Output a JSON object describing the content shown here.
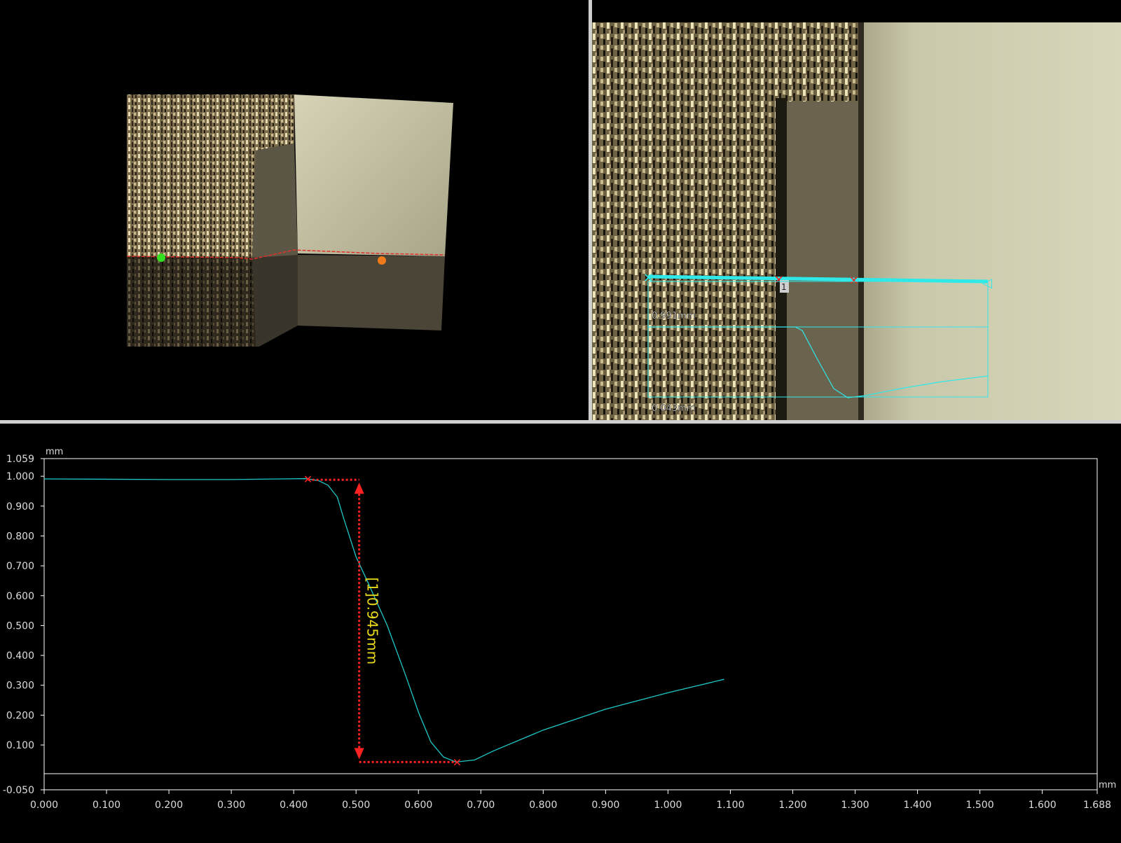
{
  "right_view": {
    "marker_number": "1",
    "max_height_label": "0.991mm",
    "min_height_label": "0.043mm"
  },
  "graph": {
    "y_unit": "mm",
    "x_unit": "mm",
    "measurement_label": "[1]0.945mm",
    "colors": {
      "profile": "#1fc7c7",
      "measurement": "#ff2222",
      "measurement_text": "#e8d81a",
      "axes": "#ffffff"
    }
  },
  "chart_data": {
    "type": "line",
    "xlabel": "mm",
    "ylabel": "mm",
    "xlim": [
      0.0,
      1.688
    ],
    "ylim": [
      -0.05,
      1.059
    ],
    "x_ticks": [
      "0.000",
      "0.100",
      "0.200",
      "0.300",
      "0.400",
      "0.500",
      "0.600",
      "0.700",
      "0.800",
      "0.900",
      "1.000",
      "1.100",
      "1.200",
      "1.300",
      "1.400",
      "1.500",
      "1.600",
      "1.688"
    ],
    "y_ticks": [
      "1.059",
      "1.000",
      "0.900",
      "0.800",
      "0.700",
      "0.600",
      "0.500",
      "0.400",
      "0.300",
      "0.200",
      "0.100",
      "-0.050"
    ],
    "series": [
      {
        "x": [
          0.0,
          0.1,
          0.2,
          0.3,
          0.38,
          0.42,
          0.44,
          0.455,
          0.47,
          0.48,
          0.5,
          0.52,
          0.55,
          0.58,
          0.6,
          0.62,
          0.64,
          0.66,
          0.69,
          0.72,
          0.8,
          0.9,
          1.0,
          1.09
        ],
        "y": [
          0.991,
          0.99,
          0.989,
          0.989,
          0.991,
          0.992,
          0.985,
          0.97,
          0.93,
          0.86,
          0.73,
          0.64,
          0.5,
          0.33,
          0.21,
          0.11,
          0.06,
          0.043,
          0.05,
          0.08,
          0.15,
          0.22,
          0.275,
          0.32
        ]
      }
    ],
    "annotations": [
      {
        "type": "vertical_dimension",
        "label": "[1]0.945mm",
        "x": 0.505,
        "y_top": 0.988,
        "y_bottom": 0.043,
        "point_a": {
          "x": 0.423,
          "y": 0.991
        },
        "point_b": {
          "x": 0.662,
          "y": 0.043
        }
      }
    ],
    "grid": false
  }
}
